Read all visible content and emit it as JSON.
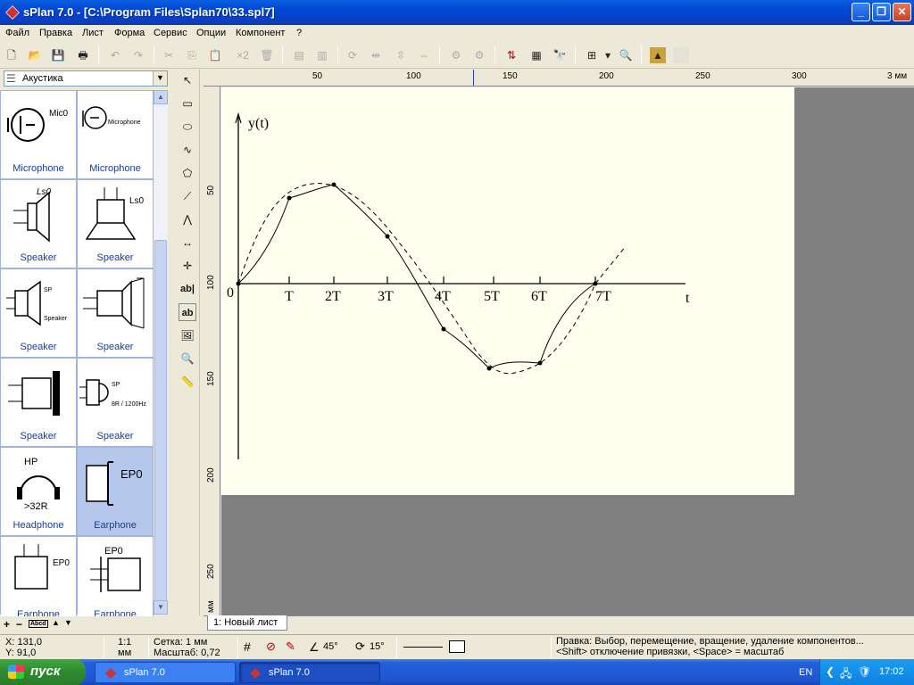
{
  "window": {
    "title": "sPlan 7.0 - [C:\\Program Files\\Splan70\\33.spl7]"
  },
  "menu": [
    "Файл",
    "Правка",
    "Лист",
    "Форма",
    "Сервис",
    "Опции",
    "Компонент",
    "?"
  ],
  "toolbar": {
    "x2_label": "×2"
  },
  "library": {
    "category": "Акустика",
    "items": [
      {
        "label": "Microphone",
        "tag": "Mic0"
      },
      {
        "label": "Microphone",
        "tag": "Microphone"
      },
      {
        "label": "Speaker",
        "tag": "Ls0"
      },
      {
        "label": "Speaker",
        "tag": "Ls0"
      },
      {
        "label": "Speaker",
        "tag": "SP",
        "tag2": "Speaker"
      },
      {
        "label": "Speaker"
      },
      {
        "label": "Speaker"
      },
      {
        "label": "Speaker",
        "tag": "SP",
        "tag2": "8R / 1200Hz"
      },
      {
        "label": "Headphone",
        "tag": "HP",
        "tag2": ">32R"
      },
      {
        "label": "Earphone",
        "tag": "EP0"
      },
      {
        "label": "Earphone",
        "tag": "EP0"
      },
      {
        "label": "Earphone",
        "tag": "EP0"
      }
    ],
    "footer": {
      "add": "+",
      "remove": "−",
      "rename": "Abcd",
      "up": "▲",
      "down": "▼"
    }
  },
  "tools": {
    "text_tool": "ab|",
    "textbox_tool": "ab"
  },
  "rulers": {
    "h_labels": [
      "50",
      "100",
      "150",
      "200",
      "250",
      "300",
      "3 мм"
    ],
    "v_labels": [
      "50",
      "100",
      "150",
      "200",
      "250",
      "мм"
    ]
  },
  "drawing": {
    "y_label": "y(t)",
    "t_label": "t",
    "origin_label": "0",
    "tick_labels": [
      "T",
      "2T",
      "3T",
      "4T",
      "5T",
      "6T",
      "7T"
    ]
  },
  "sheet_tab": "1: Новый лист",
  "status": {
    "x": "X: 131,0",
    "y": "Y: 91,0",
    "ratio": "1:1",
    "unit": "мм",
    "grid": "Сетка: 1 мм",
    "scale": "Масштаб:  0,72",
    "angle1": "45°",
    "angle2": "15°",
    "hint1": "Правка: Выбор, перемещение, вращение, удаление компонентов...",
    "hint2": "<Shift> отключение привязки, <Space> = масштаб"
  },
  "taskbar": {
    "start": "пуск",
    "tasks": [
      "sPlan 7.0",
      "sPlan 7.0"
    ],
    "lang": "EN",
    "clock": "17:02"
  }
}
